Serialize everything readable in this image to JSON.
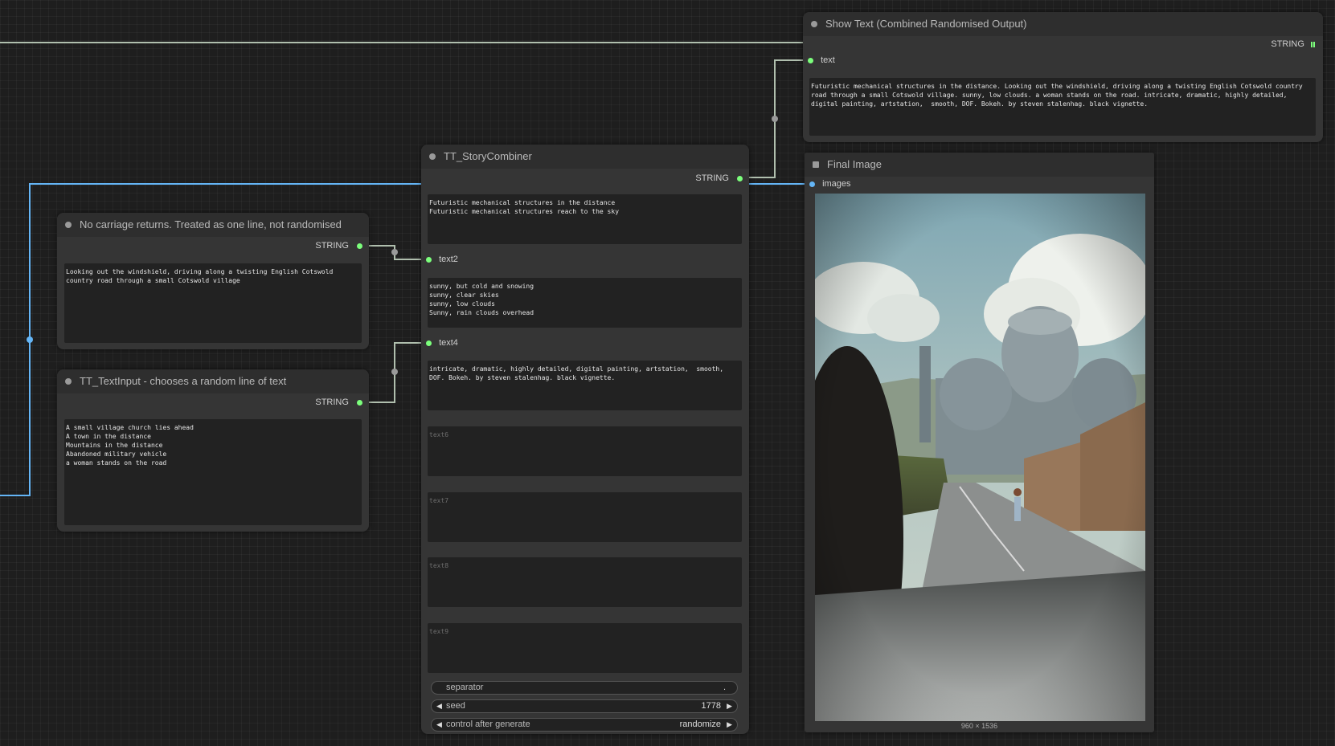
{
  "colors": {
    "canvas_bg": "#1e1e1e",
    "node_bg": "#353535",
    "node_title_bg": "#2e2e2e",
    "string_wire": "#b0bfae",
    "image_wire": "#64b5f6",
    "string_slot": "#7cff7c"
  },
  "nodes": {
    "show_text": {
      "title": "Show Text (Combined Randomised Output)",
      "output_label": "STRING",
      "input_label": "text",
      "text": "Futuristic mechanical structures in the distance. Looking out the windshield, driving along a twisting English Cotswold country road through a small Cotswold village. sunny, low clouds. a woman stands on the road. intricate, dramatic, highly detailed, digital painting, artstation,  smooth, DOF. Bokeh. by steven stalenhag. black vignette."
    },
    "story_combiner": {
      "title": "TT_StoryCombiner",
      "output_label": "STRING",
      "text1": "Futuristic mechanical structures in the distance\nFuturistic mechanical structures reach to the sky",
      "text2_label": "text2",
      "text3": "sunny, but cold and snowing\nsunny, clear skies\nsunny, low clouds\nSunny, rain clouds overhead",
      "text4_label": "text4",
      "text5": "intricate, dramatic, highly detailed, digital painting, artstation,  smooth, DOF. Bokeh. by steven stalenhag. black vignette.",
      "text6_placeholder": "text6",
      "text7_placeholder": "text7",
      "text8_placeholder": "text8",
      "text9_placeholder": "text9",
      "separator_label": "separator",
      "separator_value": ".",
      "seed_label": "seed",
      "seed_value": "1778",
      "control_label": "control after generate",
      "control_value": "randomize"
    },
    "no_carriage": {
      "title": "No carriage returns. Treated as one line, not randomised",
      "output_label": "STRING",
      "text": "Looking out the windshield, driving along a twisting English Cotswold country road through a small Cotswold village"
    },
    "text_input": {
      "title": "TT_TextInput - chooses a random line of text",
      "output_label": "STRING",
      "text": "A small village church lies ahead\nA town in the distance\nMountains in the distance\nAbandoned military vehicle\na woman stands on the road"
    },
    "final_image": {
      "title": "Final Image",
      "input_label": "images",
      "dimensions": "960 × 1536"
    }
  },
  "icons": {
    "arrow_left": "◀",
    "arrow_right": "▶",
    "grid": "grid-icon"
  }
}
